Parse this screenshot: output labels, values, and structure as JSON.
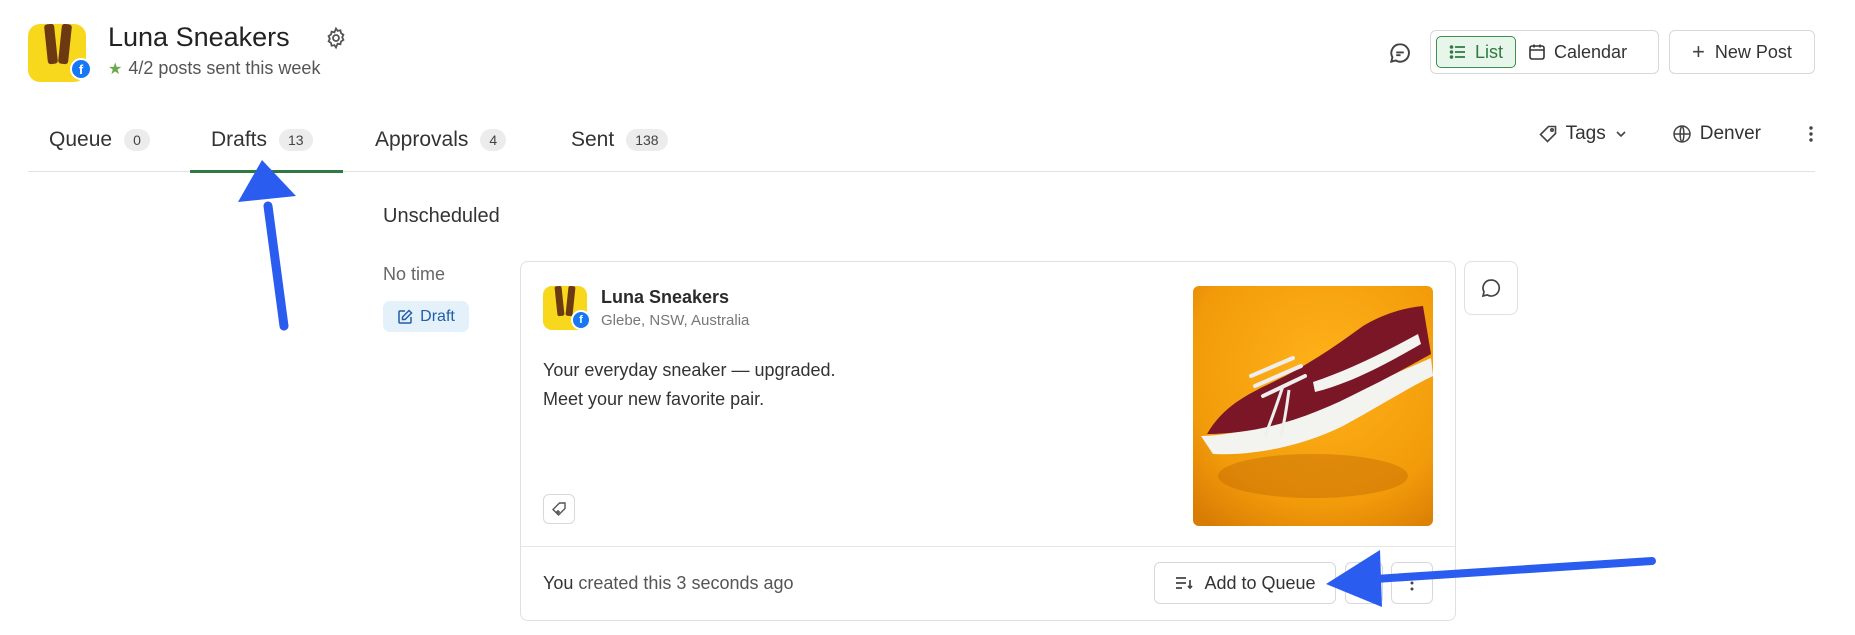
{
  "header": {
    "brand_name": "Luna Sneakers",
    "posts_stat": "4/2 posts sent this week",
    "view_list_label": "List",
    "view_calendar_label": "Calendar",
    "new_post_label": "New Post"
  },
  "tabs": [
    {
      "label": "Queue",
      "count": "0"
    },
    {
      "label": "Drafts",
      "count": "13"
    },
    {
      "label": "Approvals",
      "count": "4"
    },
    {
      "label": "Sent",
      "count": "138"
    }
  ],
  "tools": {
    "tags_label": "Tags",
    "timezone_label": "Denver"
  },
  "content": {
    "section_title": "Unscheduled",
    "time_label": "No time",
    "status_label": "Draft"
  },
  "card": {
    "author": "Luna Sneakers",
    "location": "Glebe, NSW, Australia",
    "text_line1": "Your everyday sneaker — upgraded.",
    "text_line2": "Meet your new favorite pair.",
    "footer_who": "You",
    "footer_rest": " created this 3 seconds ago",
    "add_to_queue_label": "Add to Queue"
  },
  "colors": {
    "accent_green": "#2f7a43",
    "facebook_blue": "#1877f2",
    "annotation_arrow": "#2b5cf0",
    "brand_yellow": "#f7d81c"
  }
}
